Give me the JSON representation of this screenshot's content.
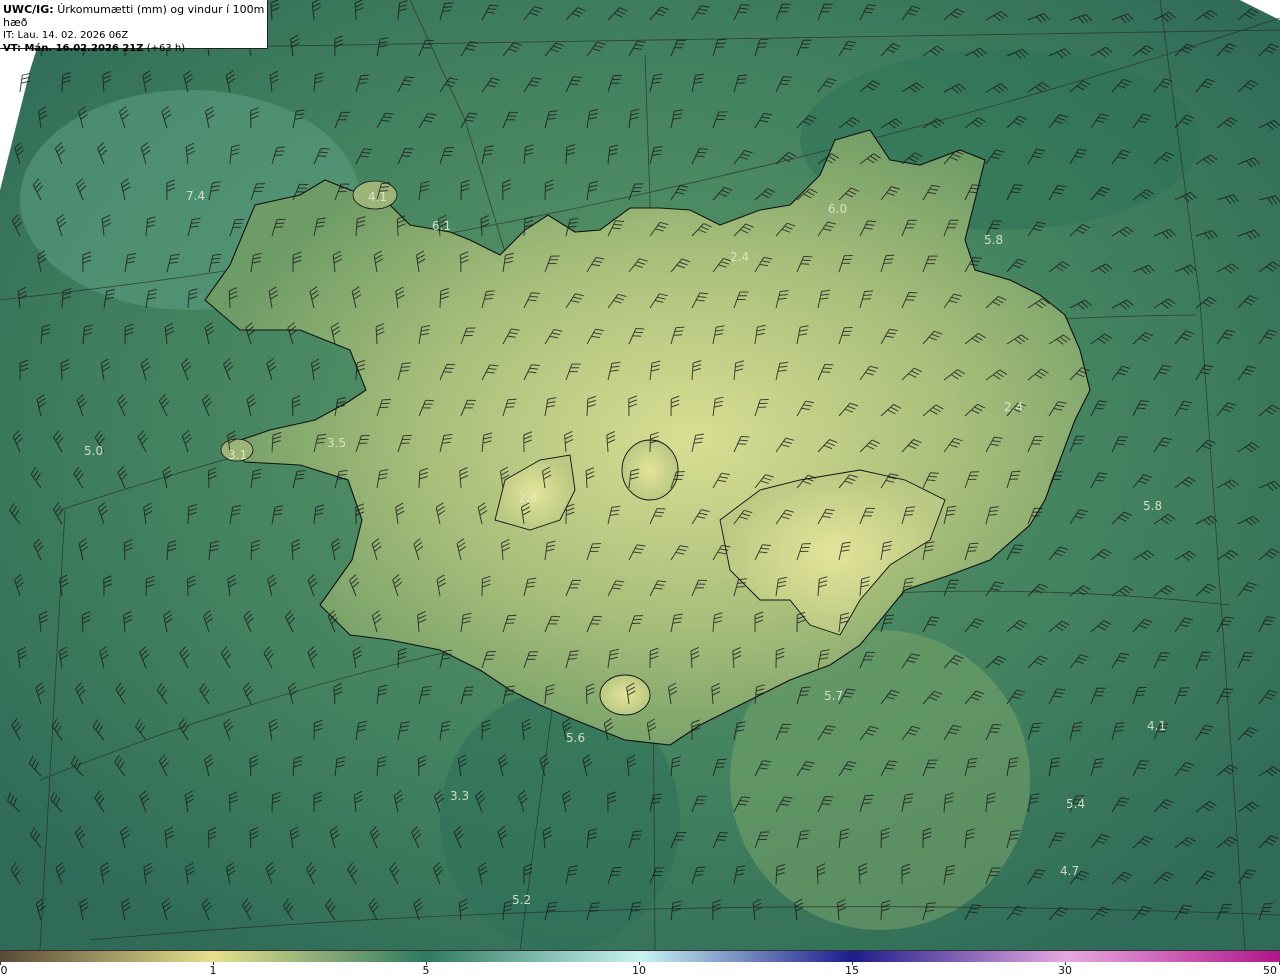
{
  "header": {
    "product_code": "UWC/IG:",
    "product_title": "Úrkomumætti (mm) og vindur í 100m hæð",
    "it_line": "IT: Lau. 14. 02. 2026 06Z",
    "vt_prefix": "VT: Mán. 16.02.2026 21Z",
    "vt_suffix": "(+63 h)"
  },
  "colors": {
    "sea_dark": "#2f6b58",
    "sea_mid": "#47866a",
    "land_low": "#6e9c66",
    "land_high": "#d9de93",
    "coast_line": "#111111",
    "grid_line": "#2a2a2a",
    "barb": "#1a1a1a"
  },
  "value_labels": [
    {
      "text": "7.4"
    },
    {
      "text": "4.1"
    },
    {
      "text": "6.1"
    },
    {
      "text": "6.0"
    },
    {
      "text": "5.8"
    },
    {
      "text": "2.4"
    },
    {
      "text": "2.4"
    },
    {
      "text": "5.0"
    },
    {
      "text": "3.1"
    },
    {
      "text": "3.5"
    },
    {
      "text": "2.8"
    },
    {
      "text": "5.8"
    },
    {
      "text": "5.7"
    },
    {
      "text": "5.6"
    },
    {
      "text": "4.1"
    },
    {
      "text": "3.3"
    },
    {
      "text": "5.4"
    },
    {
      "text": "4.7"
    },
    {
      "text": "5.2"
    }
  ],
  "colorbar": {
    "ticks": [
      "0",
      "1",
      "5",
      "10",
      "15",
      "30",
      "50"
    ],
    "stops": [
      "#5a4a36",
      "#e7e08c",
      "#2f7a60",
      "#c8f4f2",
      "#1c1c8c",
      "#e8a8e0",
      "#b0158a"
    ]
  }
}
